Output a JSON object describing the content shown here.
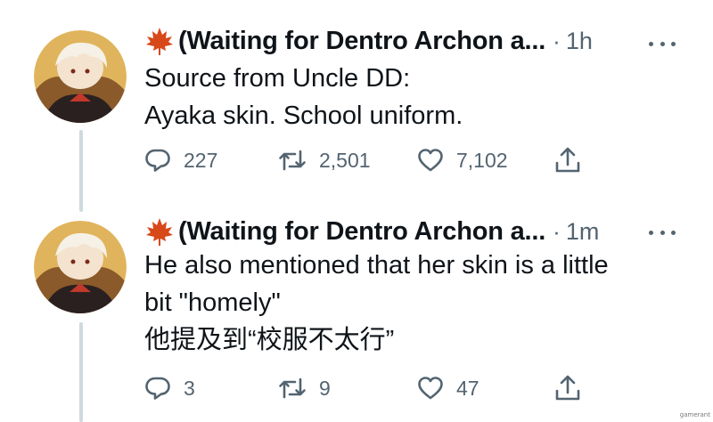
{
  "tweets": [
    {
      "display_name": "(Waiting for Dentro Archon a...",
      "separator": "·",
      "timestamp": "1h",
      "lines": [
        "Source from Uncle DD:",
        "Ayaka skin. School uniform."
      ],
      "reply_count": "227",
      "retweet_count": "2,501",
      "like_count": "7,102"
    },
    {
      "display_name": "(Waiting for Dentro Archon a...",
      "separator": "·",
      "timestamp": "1m",
      "lines": [
        "He also mentioned that her skin is a little",
        "bit \"homely\"",
        "他提及到“校服不太行”"
      ],
      "reply_count": "3",
      "retweet_count": "9",
      "like_count": "47"
    }
  ],
  "watermark": "gamerant",
  "icons": {
    "name_emoji": "maple-leaf-icon",
    "more": "more-icon",
    "reply": "reply-icon",
    "retweet": "retweet-icon",
    "like": "like-icon",
    "share": "share-icon"
  },
  "colors": {
    "text": "#0f1419",
    "secondary": "#536471",
    "thread_line": "#cfd9de",
    "maple_leaf": "#d8491a"
  }
}
